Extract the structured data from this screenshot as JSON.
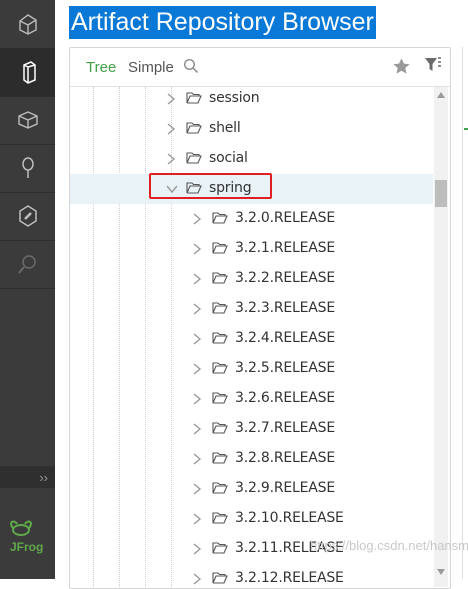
{
  "page": {
    "title": "Artifact Repository Browser"
  },
  "sidebar": {
    "items": [
      {
        "name": "home-icon"
      },
      {
        "name": "artifacts-icon"
      },
      {
        "name": "builds-icon"
      },
      {
        "name": "search-icon"
      },
      {
        "name": "admin-icon"
      },
      {
        "name": "xray-icon"
      }
    ],
    "expand_label": "››",
    "logo_text": "JFrog"
  },
  "browser": {
    "tabs": {
      "tree": "Tree",
      "simple": "Simple"
    },
    "colors": {
      "active_tab": "#43a047",
      "highlight": "#e02020",
      "selected_row": "#e9f2f7"
    }
  },
  "tree": {
    "parents": [
      {
        "label": "session"
      },
      {
        "label": "shell"
      },
      {
        "label": "social"
      }
    ],
    "selected": {
      "label": "spring",
      "expanded": true
    },
    "children": [
      {
        "label": "3.2.0.RELEASE"
      },
      {
        "label": "3.2.1.RELEASE"
      },
      {
        "label": "3.2.2.RELEASE"
      },
      {
        "label": "3.2.3.RELEASE"
      },
      {
        "label": "3.2.4.RELEASE"
      },
      {
        "label": "3.2.5.RELEASE"
      },
      {
        "label": "3.2.6.RELEASE"
      },
      {
        "label": "3.2.7.RELEASE"
      },
      {
        "label": "3.2.8.RELEASE"
      },
      {
        "label": "3.2.9.RELEASE"
      },
      {
        "label": "3.2.10.RELEASE"
      },
      {
        "label": "3.2.11.RELEASE"
      },
      {
        "label": "3.2.12.RELEASE"
      }
    ]
  },
  "watermark": "https://blog.csdn.net/hansmu"
}
